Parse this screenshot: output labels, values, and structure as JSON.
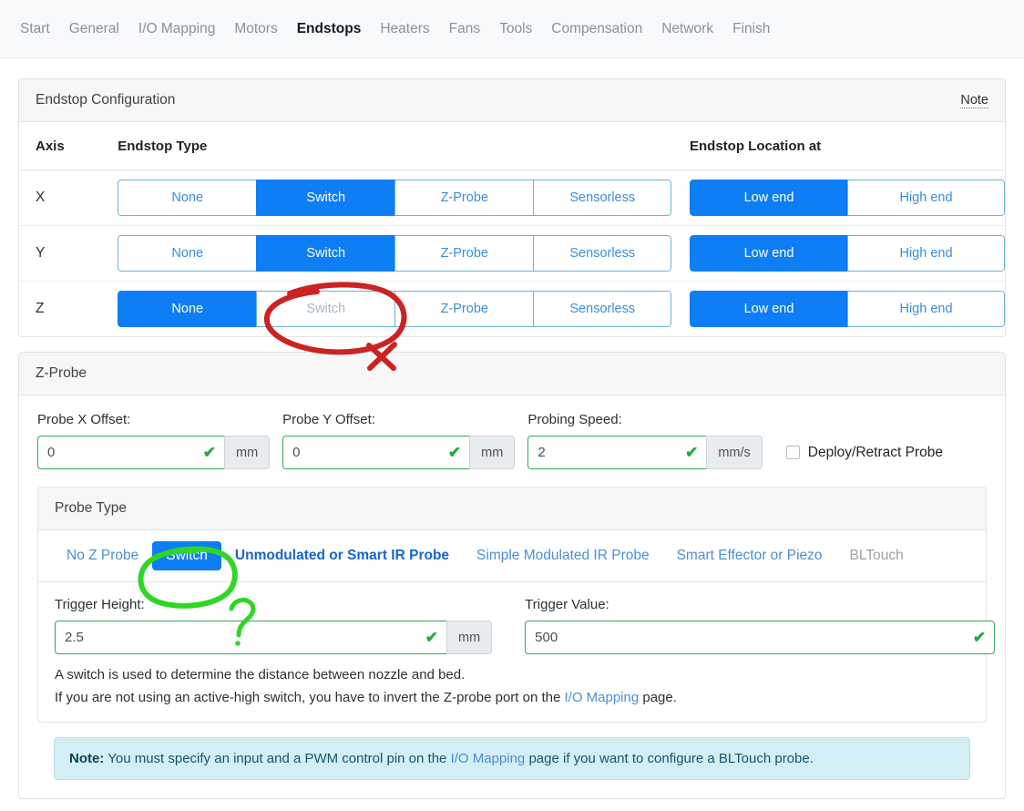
{
  "nav": {
    "items": [
      {
        "label": "Start",
        "active": false
      },
      {
        "label": "General",
        "active": false
      },
      {
        "label": "I/O Mapping",
        "active": false
      },
      {
        "label": "Motors",
        "active": false
      },
      {
        "label": "Endstops",
        "active": true
      },
      {
        "label": "Heaters",
        "active": false
      },
      {
        "label": "Fans",
        "active": false
      },
      {
        "label": "Tools",
        "active": false
      },
      {
        "label": "Compensation",
        "active": false
      },
      {
        "label": "Network",
        "active": false
      },
      {
        "label": "Finish",
        "active": false
      }
    ]
  },
  "endstop_card": {
    "title": "Endstop Configuration",
    "note_link": "Note",
    "columns": {
      "axis": "Axis",
      "type": "Endstop Type",
      "location": "Endstop Location at"
    },
    "type_options": [
      "None",
      "Switch",
      "Z-Probe",
      "Sensorless"
    ],
    "location_options": [
      "Low end",
      "High end"
    ],
    "rows": [
      {
        "axis": "X",
        "type_selected": "Switch",
        "type_disabled": [],
        "location_selected": "Low end"
      },
      {
        "axis": "Y",
        "type_selected": "Switch",
        "type_disabled": [],
        "location_selected": "Low end"
      },
      {
        "axis": "Z",
        "type_selected": "None",
        "type_disabled": [
          "Switch"
        ],
        "location_selected": "Low end"
      }
    ]
  },
  "zprobe_card": {
    "title": "Z-Probe",
    "fields": {
      "probe_x_offset": {
        "label": "Probe X Offset:",
        "value": "0",
        "unit": "mm",
        "valid": true
      },
      "probe_y_offset": {
        "label": "Probe Y Offset:",
        "value": "0",
        "unit": "mm",
        "valid": true
      },
      "probing_speed": {
        "label": "Probing Speed:",
        "value": "2",
        "unit": "mm/s",
        "valid": true
      }
    },
    "deploy_retract": {
      "label": "Deploy/Retract Probe",
      "checked": false
    },
    "probe_type": {
      "title": "Probe Type",
      "tabs": [
        {
          "label": "No Z Probe",
          "state": "normal"
        },
        {
          "label": "Switch",
          "state": "active"
        },
        {
          "label": "Unmodulated or Smart IR Probe",
          "state": "strong"
        },
        {
          "label": "Simple Modulated IR Probe",
          "state": "normal"
        },
        {
          "label": "Smart Effector or Piezo",
          "state": "normal"
        },
        {
          "label": "BLTouch",
          "state": "muted"
        }
      ],
      "trigger_height": {
        "label": "Trigger Height:",
        "value": "2.5",
        "unit": "mm",
        "valid": true
      },
      "trigger_value": {
        "label": "Trigger Value:",
        "value": "500",
        "unit": "",
        "valid": true
      },
      "description_1": "A switch is used to determine the distance between nozzle and bed.",
      "description_2_pre": "If you are not using an active-high switch, you have to invert the Z-probe port on the ",
      "description_2_link": "I/O Mapping",
      "description_2_post": " page."
    }
  },
  "alert": {
    "bold": "Note:",
    "text_pre": " You must specify an input and a PWM control pin on the ",
    "link": "I/O Mapping",
    "text_post": " page if you want to configure a BLTouch probe."
  },
  "annotations": {
    "red_color": "#cc2222",
    "green_color": "#2fd626",
    "red_circle_target": "Z row Switch button",
    "red_cross_target": "Z row Switch button rejected",
    "green_circle_target": "Probe Type Switch tab",
    "green_question_target": "Probe Type Switch tab questioned"
  }
}
